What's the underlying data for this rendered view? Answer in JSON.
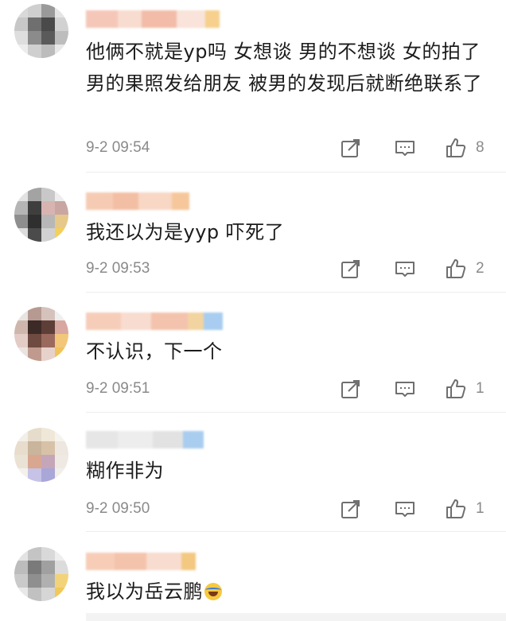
{
  "comments": [
    {
      "text": "他俩不就是yp吗 女想谈 男的不想谈 女的拍了男的果照发给朋友 被男的发现后就断绝联系了",
      "time": "9-2 09:54",
      "likes": "8"
    },
    {
      "text": "我还以为是yyp 吓死了",
      "time": "9-2 09:53",
      "likes": "2"
    },
    {
      "text": "不认识，下一个",
      "time": "9-2 09:51",
      "likes": "1"
    },
    {
      "text": "糊作非为",
      "time": "9-2 09:50",
      "likes": "1"
    },
    {
      "text": "我以为岳云鹏",
      "emoji": "laughing-crying-emoji"
    }
  ],
  "icons": {
    "share": "share-icon",
    "reply": "comment-icon",
    "like": "thumbs-up-icon"
  },
  "colors": {
    "meta_text": "#8a8a8a",
    "body_text": "#1c1c1c",
    "divider": "#ececec",
    "icon_stroke": "#6f6f6f"
  }
}
